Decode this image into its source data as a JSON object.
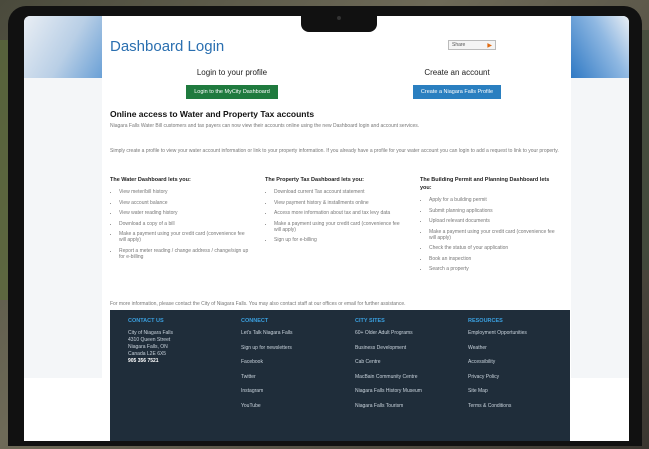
{
  "page": {
    "title": "Dashboard Login",
    "share_label": "Share"
  },
  "login": {
    "heading": "Login to your profile",
    "button": "Login to the MyCity Dashboard"
  },
  "create": {
    "heading": "Create an account",
    "button": "Create a Niagara Falls Profile"
  },
  "section": {
    "heading": "Online access to Water and Property Tax accounts",
    "intro": "Niagara Falls Water Bill customers and tax payers can now view their accounts online using the new Dashboard login and account services.",
    "intro2": "Simply create a profile to view your water account information or link to your property information. If you already have a profile for your water account you can login to add a request to link to your property."
  },
  "columns": [
    {
      "heading": "The Water Dashboard lets you:",
      "items": [
        "View meter/bill history",
        "View account balance",
        "View water reading history",
        "Download a copy of a bill",
        "Make a payment using your credit card (convenience fee will apply)",
        "Report a meter reading / change address / change/sign up for e-billing"
      ]
    },
    {
      "heading": "The Property Tax Dashboard lets you:",
      "items": [
        "Download current Tax account statement",
        "View payment history & installments online",
        "Access more information about tax and tax levy data",
        "Make a payment using your credit card (convenience fee will apply)",
        "Sign up for e-billing"
      ]
    },
    {
      "heading": "The Building Permit and Planning Dashboard lets you:",
      "items": [
        "Apply for a building permit",
        "Submit planning applications",
        "Upload relevant documents",
        "Make a payment using your credit card (convenience fee will apply)",
        "Check the status of your application",
        "Book an inspection",
        "Search a property"
      ]
    }
  ],
  "more_info": "For more information, please contact the City of Niagara Falls. You may also contact staff at our offices or email for further assistance.",
  "footer": {
    "contact": {
      "heading": "CONTACT US",
      "lines": [
        "City of Niagara Falls",
        "4310 Queen Street",
        "Niagara Falls, ON",
        "Canada L2E 6X5"
      ],
      "phone": "905 356 7521"
    },
    "connect": {
      "heading": "CONNECT",
      "items": [
        "Let's Talk Niagara Falls",
        "Sign up for newsletters",
        "Facebook",
        "Twitter",
        "Instagram",
        "YouTube"
      ]
    },
    "city_sites": {
      "heading": "CITY SITES",
      "items": [
        "60+ Older Adult Programs",
        "Business Development",
        "Cab Centre",
        "MacBain Community Centre",
        "Niagara Falls History Museum",
        "Niagara Falls Tourism"
      ]
    },
    "resources": {
      "heading": "RESOURCES",
      "items": [
        "Employment Opportunities",
        "Weather",
        "Accessibility",
        "Privacy Policy",
        "Site Map",
        "Terms & Conditions"
      ]
    }
  }
}
